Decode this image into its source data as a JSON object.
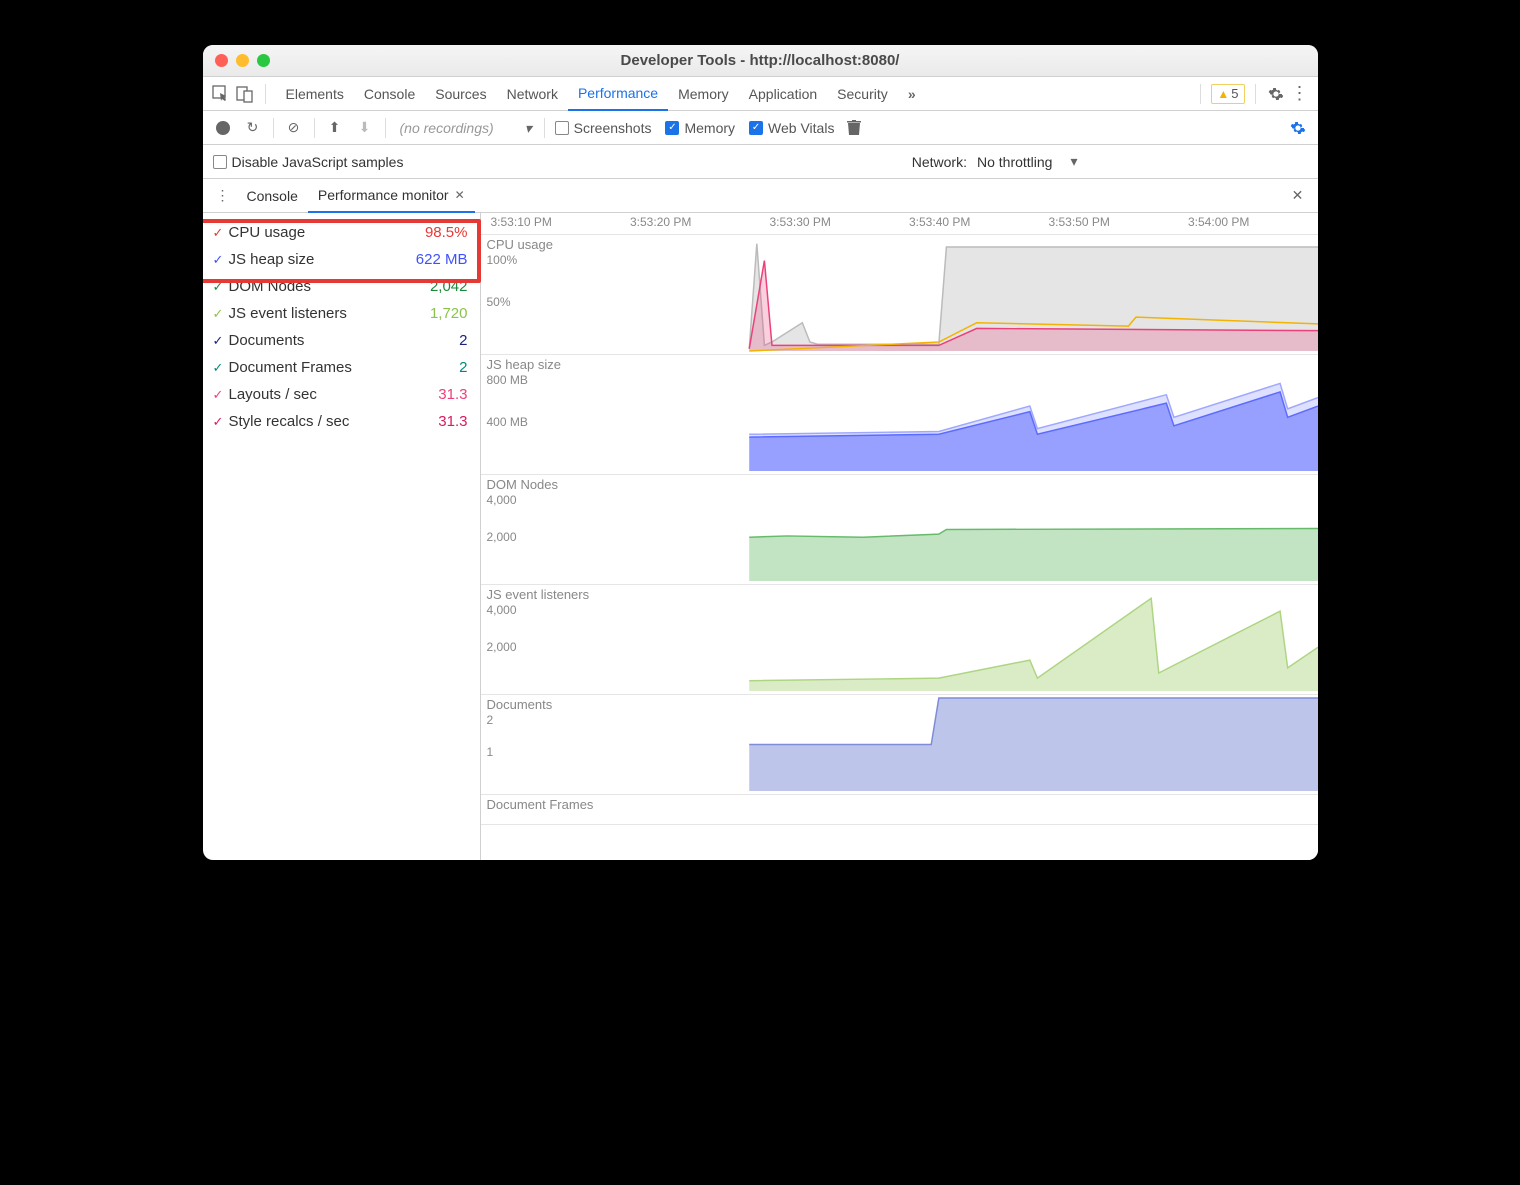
{
  "window": {
    "title": "Developer Tools - http://localhost:8080/"
  },
  "main_tabs": {
    "items": [
      "Elements",
      "Console",
      "Sources",
      "Network",
      "Performance",
      "Memory",
      "Application",
      "Security"
    ],
    "active": "Performance",
    "more_icon": "chevrons-right-icon",
    "warn_count": "5"
  },
  "perf_toolbar": {
    "recordings_placeholder": "(no recordings)",
    "checks": [
      {
        "label": "Screenshots",
        "checked": false
      },
      {
        "label": "Memory",
        "checked": true
      },
      {
        "label": "Web Vitals",
        "checked": true
      }
    ]
  },
  "sample_row": {
    "disable_js_label": "Disable JavaScript samples",
    "network_label": "Network:",
    "throttling": "No throttling"
  },
  "sub_tabs": {
    "items": [
      {
        "label": "Console",
        "closable": false,
        "active": false
      },
      {
        "label": "Performance monitor",
        "closable": true,
        "active": true
      }
    ]
  },
  "metrics": [
    {
      "label": "CPU usage",
      "value": "98.5%",
      "color": "#e53935"
    },
    {
      "label": "JS heap size",
      "value": "622 MB",
      "color": "#3f51ff"
    },
    {
      "label": "DOM Nodes",
      "value": "2,042",
      "color": "#1b8a3a"
    },
    {
      "label": "JS event listeners",
      "value": "1,720",
      "color": "#8bc34a"
    },
    {
      "label": "Documents",
      "value": "2",
      "color": "#1a237e"
    },
    {
      "label": "Document Frames",
      "value": "2",
      "color": "#00897b"
    },
    {
      "label": "Layouts / sec",
      "value": "31.3",
      "color": "#ec407a"
    },
    {
      "label": "Style recalcs / sec",
      "value": "31.3",
      "color": "#d81b60"
    }
  ],
  "time_axis": [
    "3:53:10 PM",
    "3:53:20 PM",
    "3:53:30 PM",
    "3:53:40 PM",
    "3:53:50 PM",
    "3:54:00 PM"
  ],
  "chart_data": [
    {
      "type": "line",
      "title": "CPU usage",
      "ylabels": [
        "100%",
        "50%"
      ],
      "ylim": [
        0,
        100
      ],
      "series": [
        {
          "name": "total",
          "color": "#bbb",
          "fill": "rgba(180,180,180,.35)",
          "x": [
            0.25,
            0.26,
            0.27,
            0.28,
            0.32,
            0.33,
            0.34,
            0.5,
            0.51,
            1.0
          ],
          "y": [
            2,
            95,
            5,
            8,
            25,
            8,
            6,
            6,
            92,
            92
          ]
        },
        {
          "name": "layouts",
          "color": "#ec407a",
          "fill": "rgba(236,64,122,.25)",
          "x": [
            0.25,
            0.27,
            0.28,
            0.5,
            0.55,
            1.0
          ],
          "y": [
            2,
            80,
            5,
            5,
            20,
            18
          ]
        },
        {
          "name": "style",
          "color": "#f2b400",
          "fill": "none",
          "x": [
            0.25,
            0.5,
            0.55,
            0.75,
            0.76,
            1.0
          ],
          "y": [
            0,
            8,
            25,
            22,
            30,
            24
          ]
        }
      ]
    },
    {
      "type": "area",
      "title": "JS heap size",
      "ylabels": [
        "800 MB",
        "400 MB"
      ],
      "ylim": [
        0,
        800
      ],
      "series": [
        {
          "name": "heap-total",
          "color": "#9fa8ff",
          "fill": "rgba(120,130,255,.25)",
          "x": [
            0.25,
            0.5,
            0.62,
            0.63,
            0.8,
            0.81,
            0.95,
            0.96,
            1.0
          ],
          "y": [
            260,
            280,
            460,
            300,
            540,
            380,
            620,
            440,
            520
          ]
        },
        {
          "name": "heap-used",
          "color": "#5c6bff",
          "fill": "rgba(92,107,255,.55)",
          "x": [
            0.25,
            0.5,
            0.62,
            0.63,
            0.8,
            0.81,
            0.95,
            0.96,
            1.0
          ],
          "y": [
            240,
            260,
            420,
            260,
            480,
            320,
            560,
            380,
            460
          ]
        }
      ]
    },
    {
      "type": "area",
      "title": "DOM Nodes",
      "ylabels": [
        "4,000",
        "2,000"
      ],
      "ylim": [
        0,
        4000
      ],
      "series": [
        {
          "name": "dom",
          "color": "#66bb6a",
          "fill": "rgba(102,187,106,.4)",
          "x": [
            0.25,
            0.3,
            0.4,
            0.5,
            0.51,
            1.0
          ],
          "y": [
            1700,
            1750,
            1700,
            1820,
            2000,
            2040
          ]
        }
      ]
    },
    {
      "type": "area",
      "title": "JS event listeners",
      "ylabels": [
        "4,000",
        "2,000"
      ],
      "ylim": [
        0,
        4000
      ],
      "series": [
        {
          "name": "listeners",
          "color": "#aed581",
          "fill": "rgba(174,213,129,.45)",
          "x": [
            0.25,
            0.5,
            0.62,
            0.63,
            0.78,
            0.79,
            0.95,
            0.96,
            1.0
          ],
          "y": [
            400,
            500,
            1200,
            500,
            3600,
            700,
            3100,
            900,
            1700
          ]
        }
      ]
    },
    {
      "type": "area",
      "title": "Documents",
      "ylabels": [
        "2",
        "1"
      ],
      "ylim": [
        0,
        2
      ],
      "series": [
        {
          "name": "docs",
          "color": "#7e8bd8",
          "fill": "rgba(126,139,216,.5)",
          "x": [
            0.25,
            0.49,
            0.5,
            1.0
          ],
          "y": [
            1,
            1,
            2,
            2
          ]
        }
      ]
    },
    {
      "type": "area",
      "title": "Document Frames",
      "ylabels": [],
      "ylim": [
        0,
        2
      ],
      "series": []
    }
  ]
}
